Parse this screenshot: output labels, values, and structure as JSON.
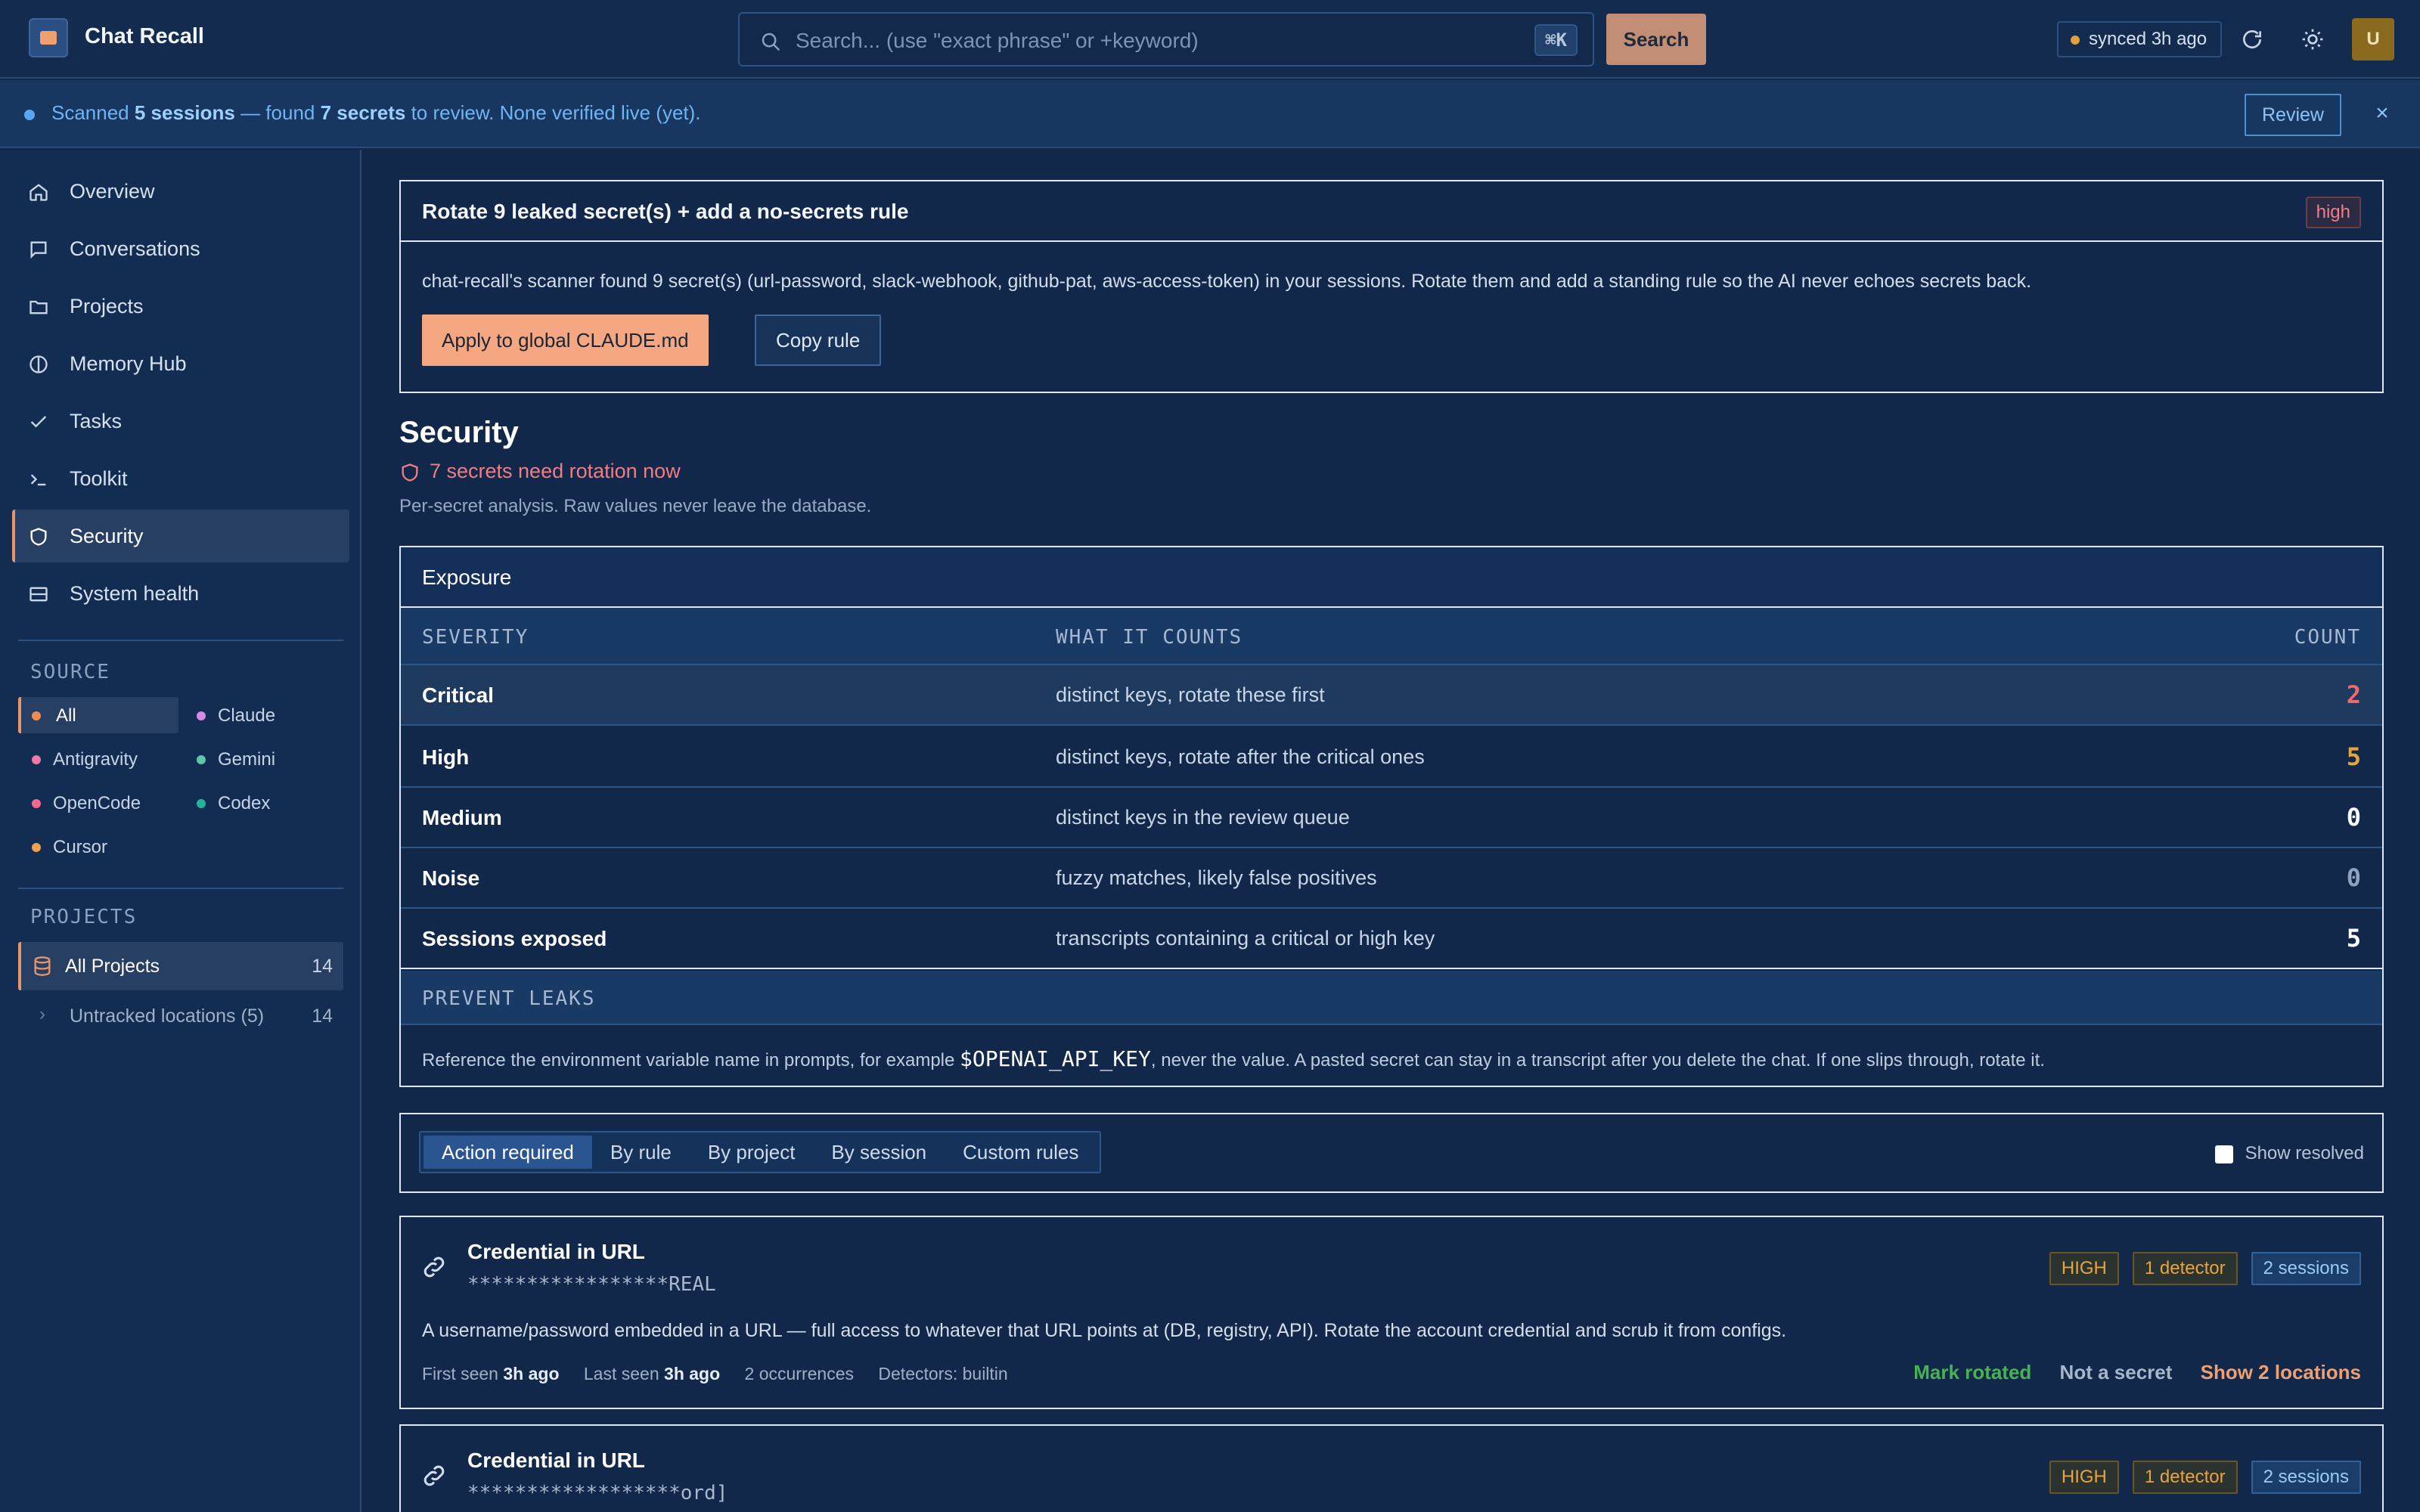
{
  "app": {
    "title": "Chat Recall"
  },
  "search": {
    "placeholder": "Search... (use \"exact phrase\" or +keyword)",
    "shortcut": "⌘K",
    "button": "Search"
  },
  "sync": {
    "status": "synced 3h ago"
  },
  "user": {
    "initial": "U"
  },
  "banner": {
    "pre": "Scanned ",
    "sessions": "5 sessions",
    "mid": " — found ",
    "secrets": "7 secrets",
    "post": " to review. None verified live (yet).",
    "review": "Review",
    "close": "×"
  },
  "nav": {
    "items": [
      {
        "label": "Overview",
        "icon": "home-icon"
      },
      {
        "label": "Conversations",
        "icon": "chat-icon"
      },
      {
        "label": "Projects",
        "icon": "folder-icon"
      },
      {
        "label": "Memory Hub",
        "icon": "brain-icon"
      },
      {
        "label": "Tasks",
        "icon": "check-icon"
      },
      {
        "label": "Toolkit",
        "icon": "terminal-icon"
      },
      {
        "label": "Security",
        "icon": "shield-icon",
        "active": true
      },
      {
        "label": "System health",
        "icon": "server-icon"
      }
    ]
  },
  "source": {
    "heading": "SOURCE",
    "items": [
      {
        "label": "All",
        "color": "#f08c4e",
        "active": true
      },
      {
        "label": "Claude",
        "color": "#d889e6"
      },
      {
        "label": "Antigravity",
        "color": "#f07aa6"
      },
      {
        "label": "Gemini",
        "color": "#5bc8a8"
      },
      {
        "label": "OpenCode",
        "color": "#f06a8e"
      },
      {
        "label": "Codex",
        "color": "#22b59a"
      },
      {
        "label": "Cursor",
        "color": "#f0a04e"
      }
    ]
  },
  "projects": {
    "heading": "PROJECTS",
    "all": {
      "label": "All Projects",
      "count": "14"
    },
    "untracked": {
      "label": "Untracked locations (5)",
      "count": "14"
    }
  },
  "rotation": {
    "title": "Rotate 9 leaked secret(s) + add a no-secrets rule",
    "badge": "high",
    "desc": "chat-recall's scanner found 9 secret(s) (url-password, slack-webhook, github-pat, aws-access-token) in your sessions. Rotate them and add a standing rule so the AI never echoes secrets back.",
    "apply": "Apply to global CLAUDE.md",
    "copy": "Copy rule"
  },
  "security": {
    "title": "Security",
    "warning": "7 secrets need rotation now",
    "subtitle": "Per-secret analysis. Raw values never leave the database."
  },
  "exposure": {
    "title": "Exposure",
    "headers": {
      "severity": "SEVERITY",
      "what": "WHAT IT COUNTS",
      "count": "COUNT"
    },
    "rows": [
      {
        "severity": "Critical",
        "what": "distinct keys, rotate these first",
        "count": "2",
        "color": "#f0686f"
      },
      {
        "severity": "High",
        "what": "distinct keys, rotate after the critical ones",
        "count": "5",
        "color": "#e8a43c"
      },
      {
        "severity": "Medium",
        "what": "distinct keys in the review queue",
        "count": "0",
        "color": "#ffffff"
      },
      {
        "severity": "Noise",
        "what": "fuzzy matches, likely false positives",
        "count": "0",
        "color": "#8ea3bf"
      },
      {
        "severity": "Sessions exposed",
        "what": "transcripts containing a critical or high key",
        "count": "5",
        "color": "#ffffff"
      }
    ],
    "prevent": {
      "heading": "PREVENT LEAKS",
      "pre": "Reference the environment variable name in prompts, for example ",
      "code": "$OPENAI_API_KEY",
      "post": ", never the value. A pasted secret can stay in a transcript after you delete the chat. If one slips through, rotate it."
    }
  },
  "tabs": {
    "items": [
      "Action required",
      "By rule",
      "By project",
      "By session",
      "Custom rules"
    ],
    "show_resolved": "Show resolved"
  },
  "findings": [
    {
      "title": "Credential in URL",
      "masked": "*****************REAL",
      "severity": "HIGH",
      "detectors": "1 detector",
      "sessions": "2 sessions",
      "desc": "A username/password embedded in a URL — full access to whatever that URL points at (DB, registry, API). Rotate the account credential and scrub it from configs.",
      "first_label": "First seen ",
      "first": "3h ago",
      "last_label": "Last seen ",
      "last": "3h ago",
      "occurrences": "2 occurrences",
      "detectors_label": "Detectors: builtin",
      "mark": "Mark rotated",
      "not_secret": "Not a secret",
      "show": "Show 2 locations"
    },
    {
      "title": "Credential in URL",
      "masked": "******************ord]",
      "severity": "HIGH",
      "detectors": "1 detector",
      "sessions": "2 sessions"
    }
  ],
  "colors": {
    "accent": "#e8956a",
    "danger": "#f0686f",
    "warning": "#e8a43c",
    "success": "#47b24f"
  }
}
